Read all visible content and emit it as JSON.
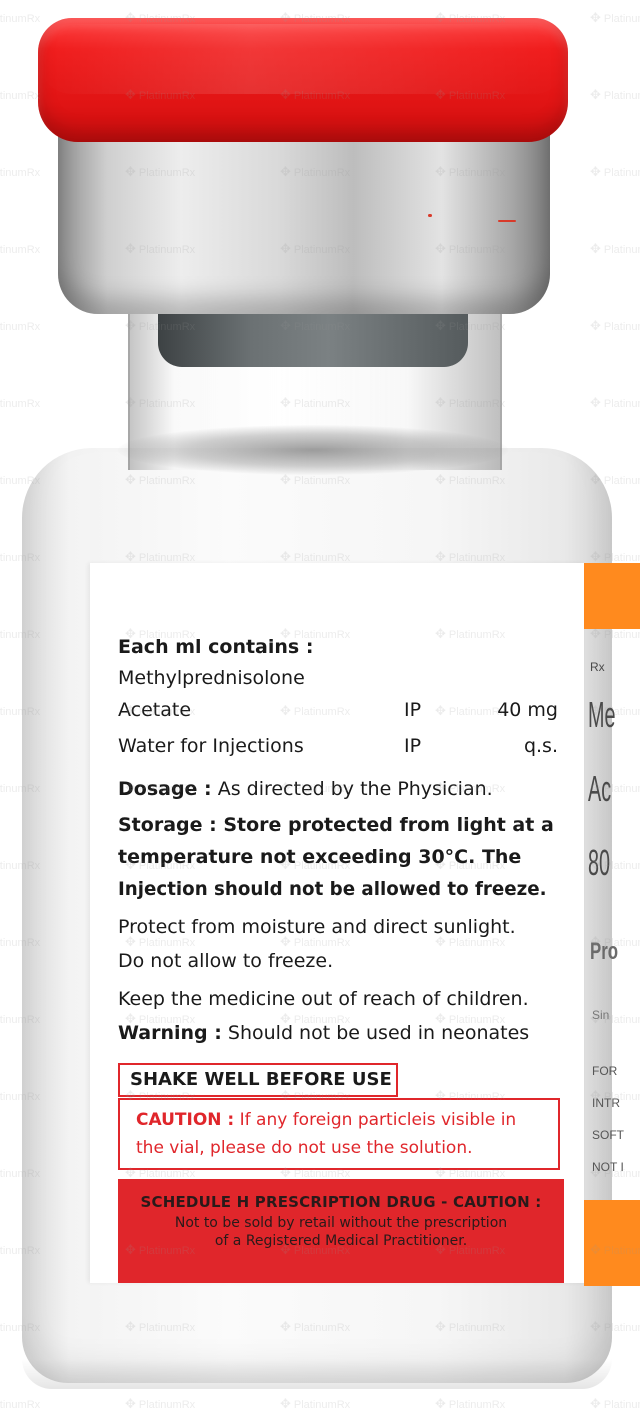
{
  "watermark": "PlatinumRx",
  "label": {
    "heading": "Each ml contains :",
    "ingredients": [
      {
        "name": "Methylprednisolone",
        "standard": "",
        "quantity": ""
      },
      {
        "name": "Acetate",
        "standard": "IP",
        "quantity": "40 mg"
      },
      {
        "name": "Water for Injections",
        "standard": "IP",
        "quantity": "q.s."
      }
    ],
    "dosage_label": "Dosage :",
    "dosage_text": "As directed by the Physician.",
    "storage_label": "Storage :",
    "storage_line1": "Store protected from light at a",
    "storage_line2": "temperature not exceeding 30°C. The",
    "storage_line3": "Injection should not be allowed to freeze.",
    "protect_line1": "Protect from moisture and direct sunlight.",
    "protect_line2": "Do not allow to freeze.",
    "keep_text": "Keep the medicine out of reach of children.",
    "warning_label": "Warning :",
    "warning_text": "Should not be used in neonates",
    "shake": "SHAKE WELL BEFORE USE",
    "caution_label": "CAUTION :",
    "caution_line1": "If any foreign particleis visible in",
    "caution_line2": "the vial, please do not use the solution.",
    "schedule_line1": "SCHEDULE H PRESCRIPTION DRUG - CAUTION :",
    "schedule_line2": "Not to be sold by retail without the prescription",
    "schedule_line3": "of a Registered Medical Practitioner."
  },
  "side_label": {
    "rx": "Rx",
    "line1": "Me",
    "line2": "Ac",
    "line3": "80",
    "line4": "Pro",
    "line5": "Sin",
    "line6": "FOR",
    "line7": "INTR",
    "line8": "SOFT",
    "line9": "NOT I"
  },
  "colors": {
    "cap_red": "#e01414",
    "label_red": "#e0262b",
    "side_orange": "#ff8a1e"
  }
}
